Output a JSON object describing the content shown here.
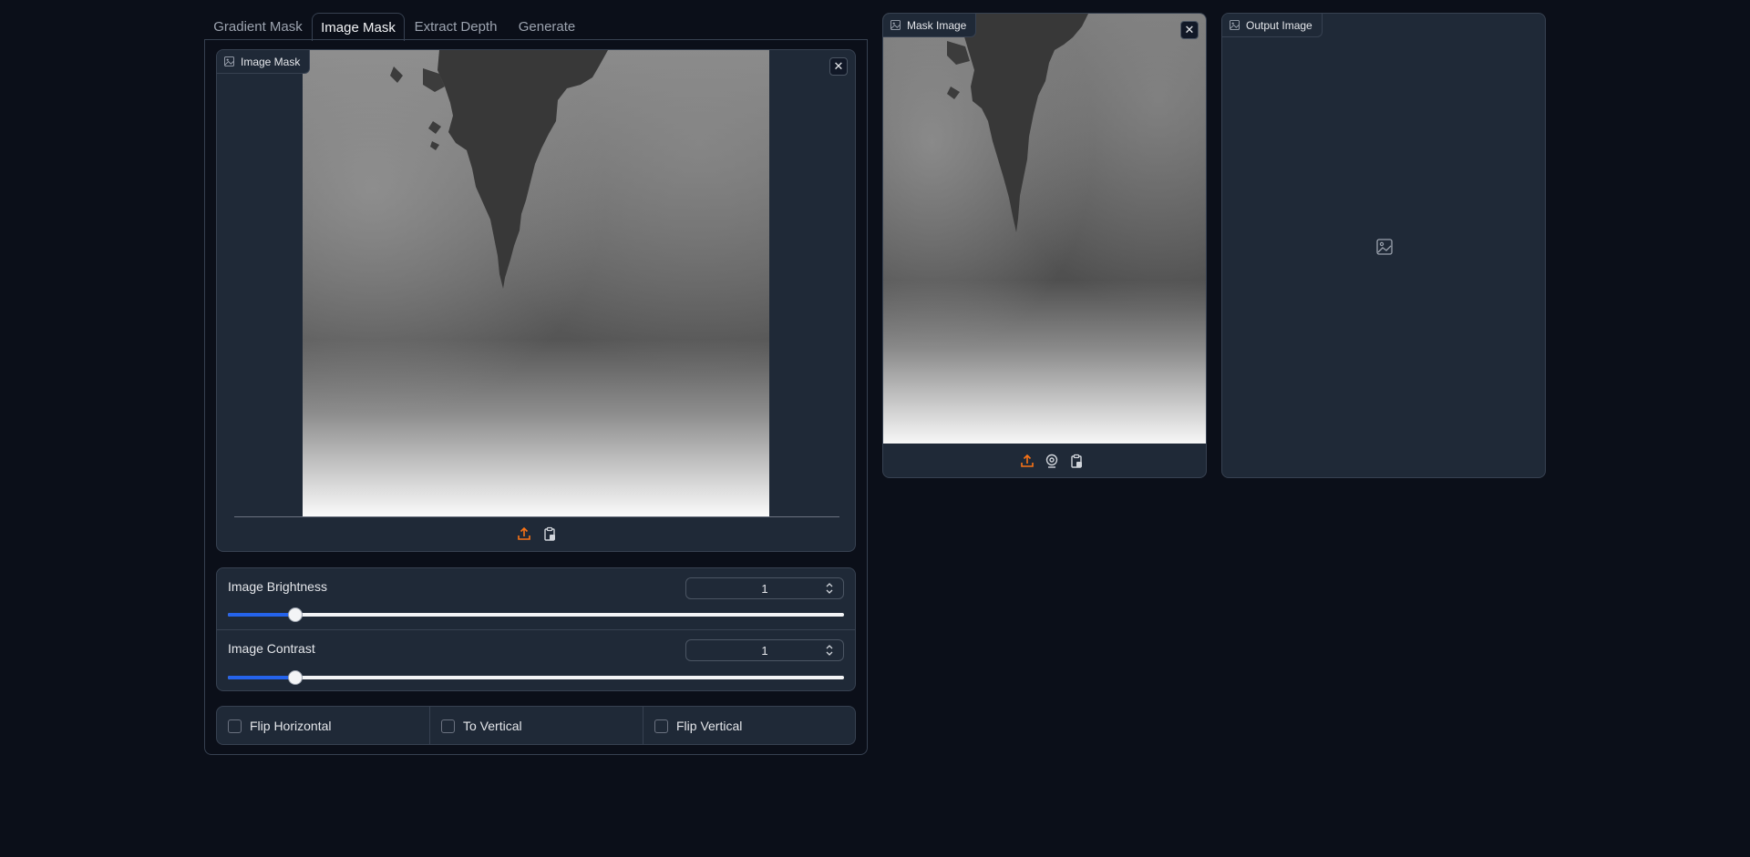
{
  "tabs": [
    {
      "label": "Gradient Mask",
      "active": false
    },
    {
      "label": "Image Mask",
      "active": true
    },
    {
      "label": "Extract Depth",
      "active": false
    },
    {
      "label": "Generate",
      "active": false
    }
  ],
  "image_mask_panel": {
    "label": "Image Mask",
    "label_icon": "image-icon",
    "close_icon": "close-icon",
    "toolbar_icons": [
      "upload-icon",
      "clipboard-icon"
    ]
  },
  "sliders": [
    {
      "label": "Image Brightness",
      "value": "1",
      "fraction": 0.11
    },
    {
      "label": "Image Contrast",
      "value": "1",
      "fraction": 0.11
    }
  ],
  "checkboxes": [
    {
      "label": "Flip Horizontal",
      "checked": false
    },
    {
      "label": "To Vertical",
      "checked": false
    },
    {
      "label": "Flip Vertical",
      "checked": false
    }
  ],
  "mask_image_panel": {
    "label": "Mask Image",
    "label_icon": "image-icon",
    "close_icon": "close-icon",
    "toolbar_icons": [
      "upload-icon",
      "webcam-icon",
      "clipboard-icon"
    ]
  },
  "output_image_panel": {
    "label": "Output Image",
    "label_icon": "image-icon",
    "placeholder_icon": "image-placeholder-icon"
  },
  "colors": {
    "background": "#0b0f19",
    "panel": "#1f2937",
    "border": "#374151",
    "accent_orange": "#f97316",
    "slider_fill": "#2563eb"
  }
}
